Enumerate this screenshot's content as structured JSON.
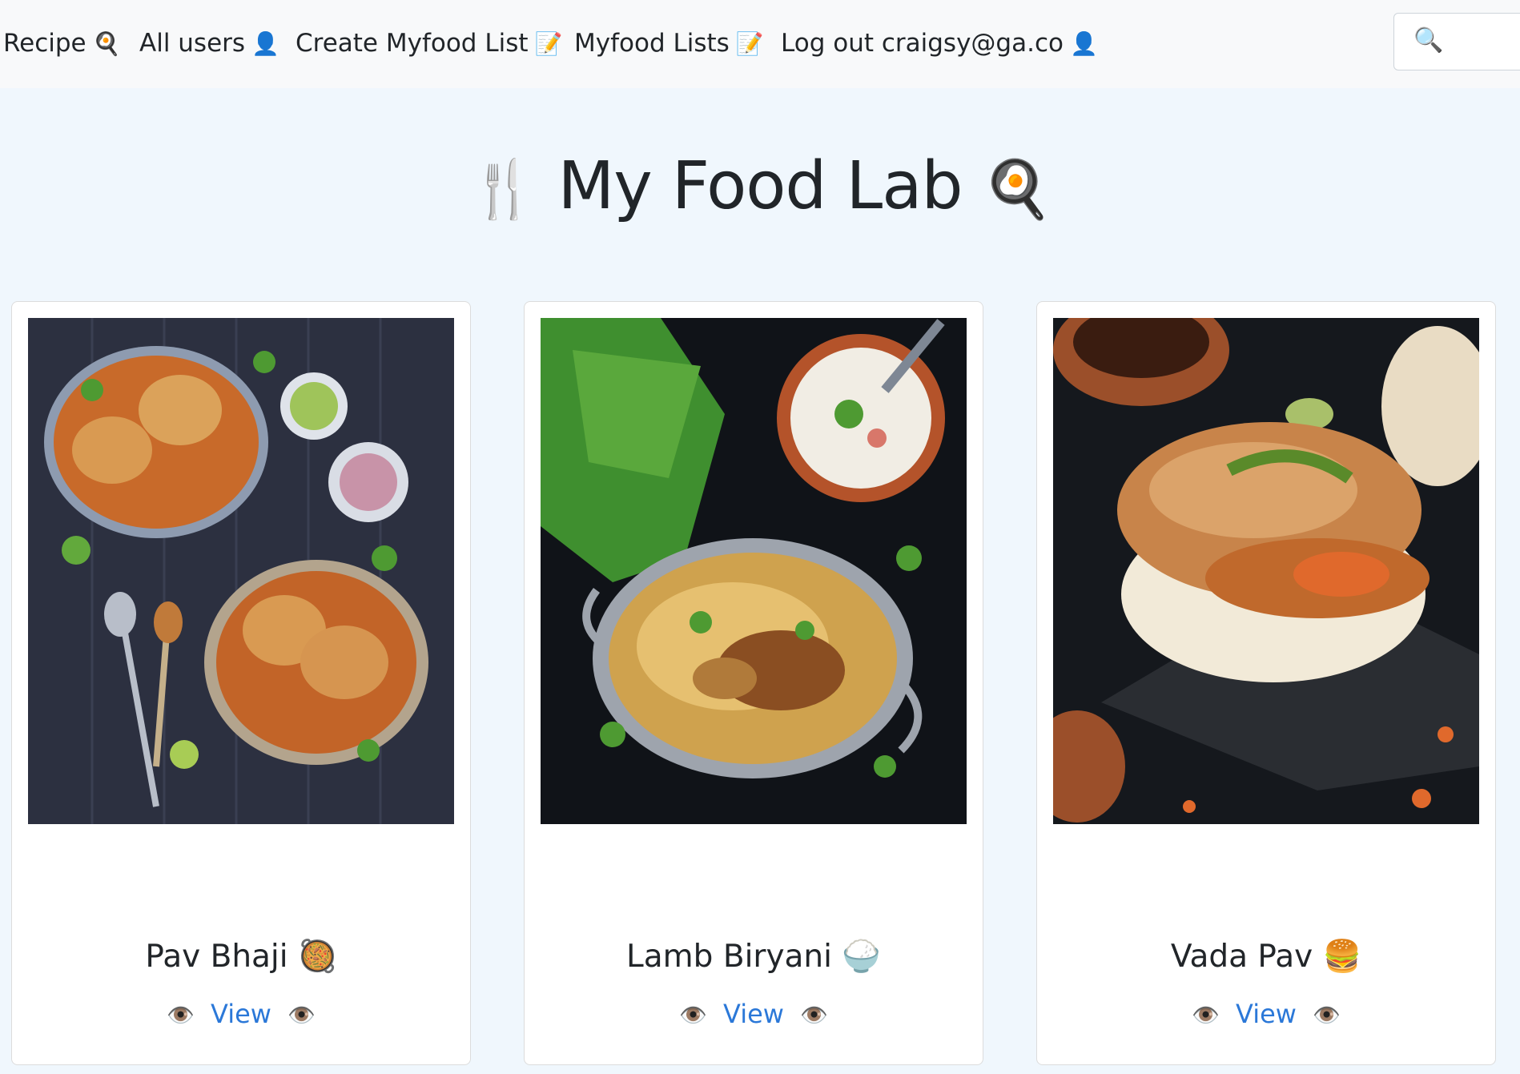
{
  "nav": {
    "items": [
      {
        "label": "Recipe",
        "emoji": "🍳"
      },
      {
        "label": "All users",
        "emoji": "👤"
      },
      {
        "label": "Create Myfood List",
        "emoji": "📝"
      },
      {
        "label": "Myfood Lists",
        "emoji": "📝"
      },
      {
        "label": "Log out craigsy@ga.co",
        "emoji": "👤"
      }
    ],
    "search": {
      "icon": "🔍",
      "placeholder": ""
    }
  },
  "page": {
    "title": "My Food Lab",
    "title_emoji_left": "🍴",
    "title_emoji_right": "🍳"
  },
  "cards": [
    {
      "title": "Pav Bhaji",
      "emoji": "🥘",
      "link_label": "View",
      "eye": "👁️"
    },
    {
      "title": "Lamb Biryani",
      "emoji": "🍚",
      "link_label": "View",
      "eye": "👁️"
    },
    {
      "title": "Vada Pav",
      "emoji": "🍔",
      "link_label": "View",
      "eye": "👁️"
    }
  ]
}
